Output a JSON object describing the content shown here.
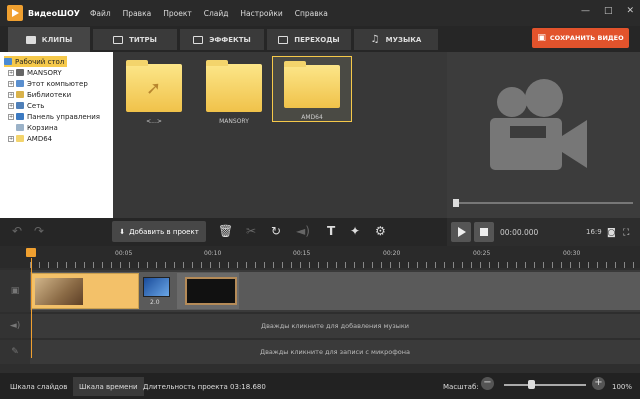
{
  "app": {
    "name": "ВидеоШОУ"
  },
  "menu": [
    "Файл",
    "Правка",
    "Проект",
    "Слайд",
    "Настройки",
    "Справка"
  ],
  "window_controls": {
    "minimize": "—",
    "maximize": "□",
    "close": "✕"
  },
  "tabs": [
    {
      "label": "КЛИПЫ",
      "icon": "film-icon",
      "active": true
    },
    {
      "label": "ТИТРЫ",
      "icon": "titles-icon",
      "active": false
    },
    {
      "label": "ЭФФЕКТЫ",
      "icon": "effects-icon",
      "active": false
    },
    {
      "label": "ПЕРЕХОДЫ",
      "icon": "transitions-icon",
      "active": false
    },
    {
      "label": "МУЗЫКА",
      "icon": "music-icon",
      "active": false
    }
  ],
  "save_button": {
    "label": "СОХРАНИТЬ ВИДЕО"
  },
  "tree": [
    {
      "label": "Рабочий стол",
      "selected": true
    },
    {
      "label": "MANSORY"
    },
    {
      "label": "Этот компьютер"
    },
    {
      "label": "Библиотеки"
    },
    {
      "label": "Сеть"
    },
    {
      "label": "Панель управления"
    },
    {
      "label": "Корзина"
    },
    {
      "label": "AMD64"
    }
  ],
  "folders": [
    {
      "label": "<...>"
    },
    {
      "label": "MANSORY"
    },
    {
      "label": "AMD64",
      "selected": true
    }
  ],
  "toolbar": {
    "add_label": "Добавить в проект"
  },
  "player": {
    "time": "00:00.000",
    "ratio": "16:9"
  },
  "ruler": [
    "00:05",
    "00:10",
    "00:15",
    "00:20",
    "00:25",
    "00:30"
  ],
  "transition": {
    "duration": "2.0"
  },
  "hints": {
    "music": "Дважды кликните для добавления музыки",
    "mic": "Дважды кликните для записи с микрофона"
  },
  "status": {
    "slides_tab": "Шкала слайдов",
    "timeline_tab": "Шкала времени",
    "duration": "Длительность проекта 03:18.680",
    "scale_label": "Масштаб:",
    "zoom": "100%",
    "minus": "−",
    "plus": "+"
  },
  "colors": {
    "accent": "#f0a030",
    "save": "#e2532c",
    "folder": "#f6c94a"
  }
}
